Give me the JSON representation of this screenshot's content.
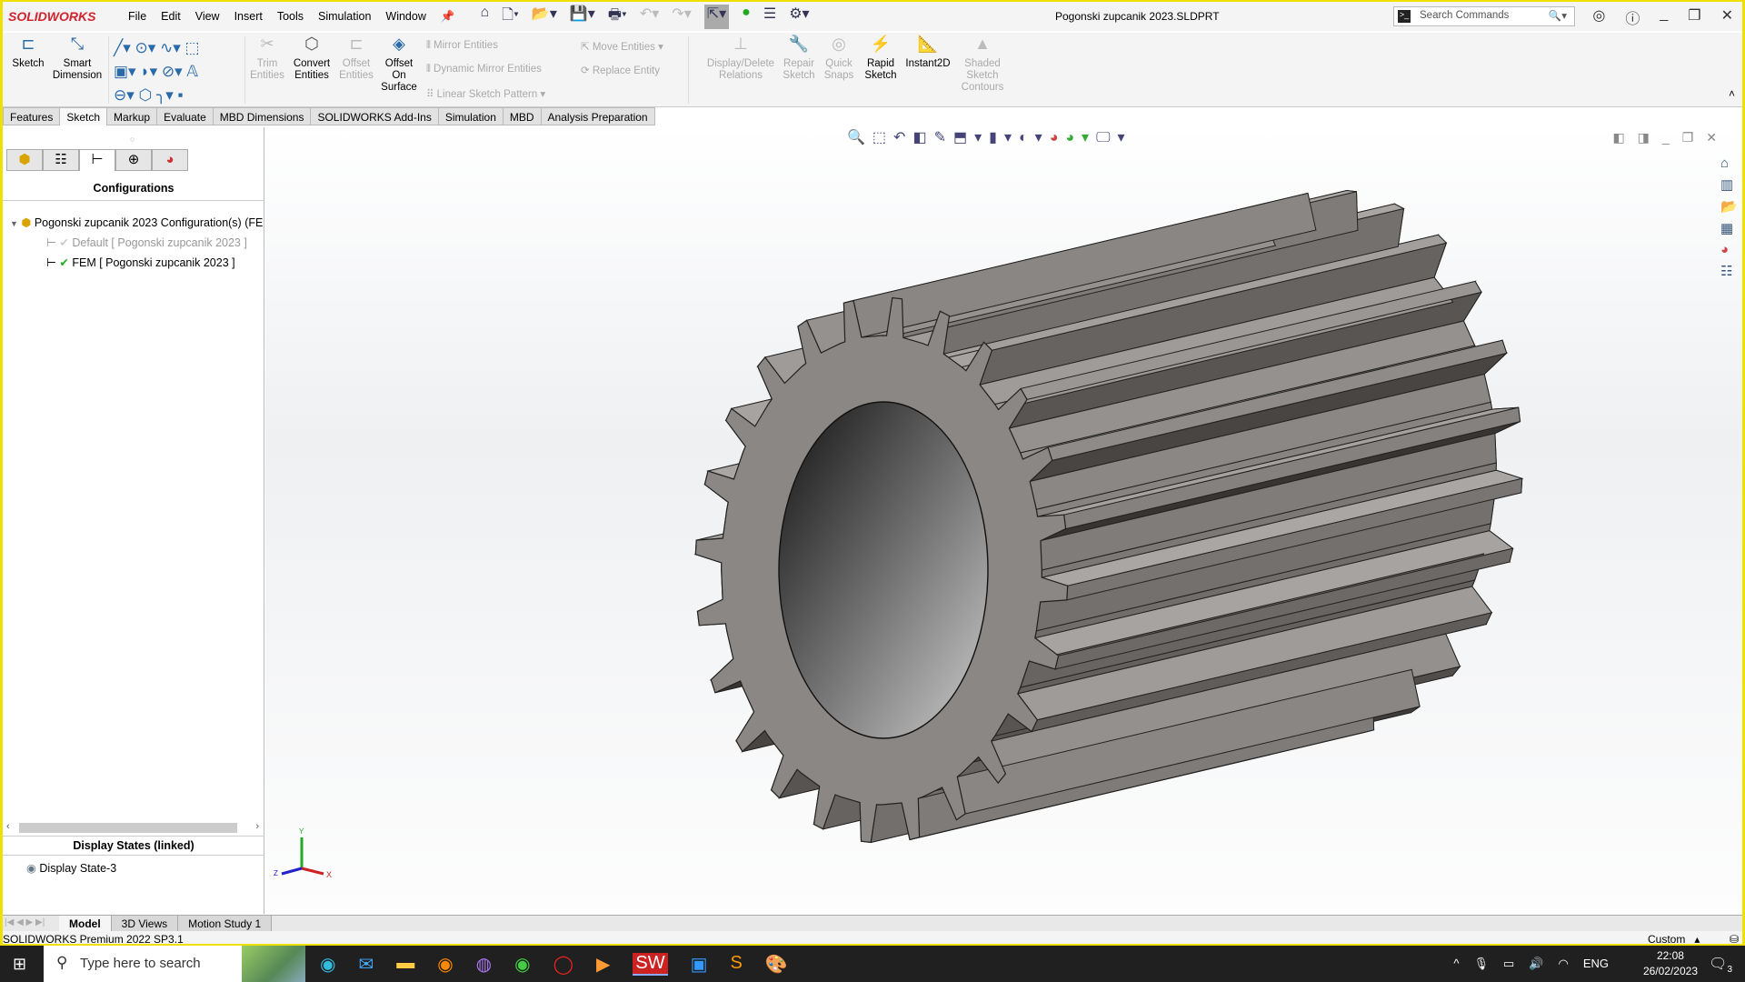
{
  "app": {
    "brand": "SOLIDWORKS",
    "title": "Pogonski zupcanik 2023.SLDPRT",
    "search_placeholder": "Search Commands"
  },
  "menu": [
    "File",
    "Edit",
    "View",
    "Insert",
    "Tools",
    "Simulation",
    "Window"
  ],
  "ribbon": {
    "sketch": "Sketch",
    "smart_dimension": "Smart Dimension",
    "trim": "Trim Entities",
    "convert": "Convert Entities",
    "offset": "Offset Entities",
    "offset_surface": "Offset On Surface",
    "mirror": "Mirror Entities",
    "dyn_mirror": "Dynamic Mirror Entities",
    "linear_pattern": "Linear Sketch Pattern",
    "move": "Move Entities",
    "replace": "Replace Entity",
    "relations": "Display/Delete Relations",
    "repair": "Repair Sketch",
    "snaps": "Quick Snaps",
    "rapid": "Rapid Sketch",
    "instant2d": "Instant2D",
    "shaded": "Shaded Sketch Contours"
  },
  "tabs": [
    "Features",
    "Sketch",
    "Markup",
    "Evaluate",
    "MBD Dimensions",
    "SOLIDWORKS Add-Ins",
    "Simulation",
    "MBD",
    "Analysis Preparation"
  ],
  "active_tab": "Sketch",
  "panel": {
    "heading": "Configurations",
    "root": "Pogonski zupcanik 2023 Configuration(s)  (FE",
    "configs": [
      {
        "name": "Default [ Pogonski zupcanik 2023 ]",
        "active": false
      },
      {
        "name": "FEM [ Pogonski zupcanik 2023 ]",
        "active": true
      }
    ],
    "display_heading": "Display States (linked)",
    "display_state": "Display State-3"
  },
  "triad": {
    "x": "X",
    "y": "Y",
    "z": "Z"
  },
  "bottom_tabs": [
    "Model",
    "3D Views",
    "Motion Study 1"
  ],
  "status": {
    "left": "SOLIDWORKS Premium 2022 SP3.1",
    "units": "Custom"
  },
  "taskbar": {
    "search": "Type here to search",
    "lang": "ENG",
    "time": "22:08",
    "date": "26/02/2023",
    "notifications": "3"
  },
  "colors": {
    "brand": "#d3232e",
    "part": "#8a8784",
    "accent": "#2a6aa8"
  }
}
